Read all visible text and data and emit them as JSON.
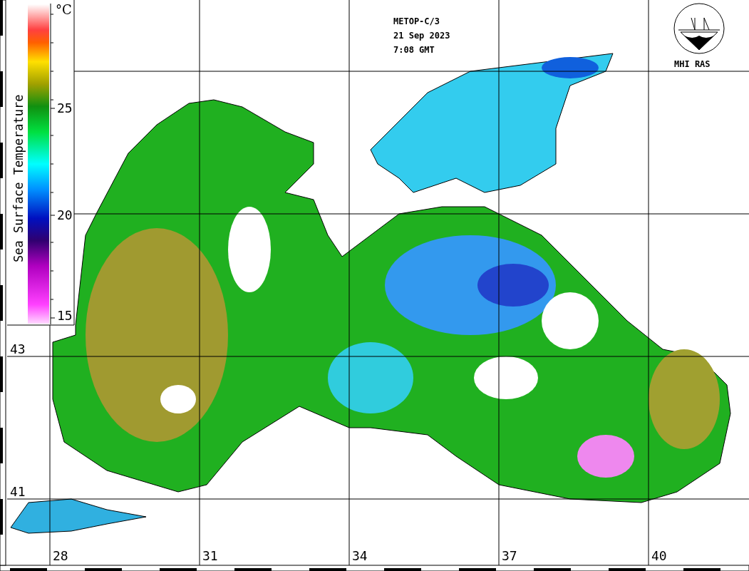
{
  "legend": {
    "title": "Sea Surface Temperature",
    "unit": "°C",
    "ticks": [
      "25",
      "20",
      "15"
    ]
  },
  "caption": [
    "METOP-C/3",
    "21 Sep 2023",
    "7:08 GMT"
  ],
  "logo": {
    "text": "MHI RAS"
  },
  "latitudes": [
    "43",
    "41"
  ],
  "longitudes": [
    "28",
    "31",
    "34",
    "37",
    "40"
  ]
}
